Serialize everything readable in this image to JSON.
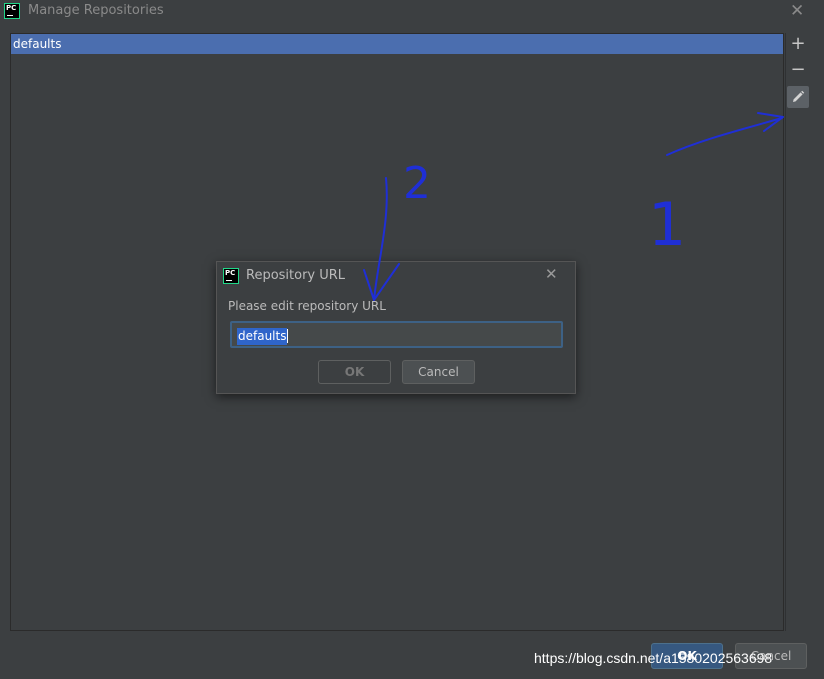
{
  "window": {
    "title": "Manage Repositories",
    "logo_text": "PC",
    "close_glyph": "✕"
  },
  "repositories": {
    "items": [
      {
        "label": "defaults",
        "selected": true
      }
    ]
  },
  "toolbar": {
    "add_glyph": "+",
    "remove_glyph": "−",
    "edit_icon": "pencil-icon"
  },
  "footer": {
    "ok_label": "OK",
    "cancel_label": "Cancel"
  },
  "watermark": "https://blog.csdn.net/a1580202563698",
  "dialog": {
    "title": "Repository URL",
    "logo_text": "PC",
    "close_glyph": "✕",
    "prompt": "Please edit repository URL",
    "input_value": "defaults",
    "ok_label": "OK",
    "cancel_label": "Cancel"
  },
  "annotations": {
    "marker_1": "1",
    "marker_2": "2",
    "color": "#1f2fd6"
  },
  "colors": {
    "selection": "#4b6eaf",
    "background": "#3c3f41",
    "primary_button": "#365880"
  }
}
